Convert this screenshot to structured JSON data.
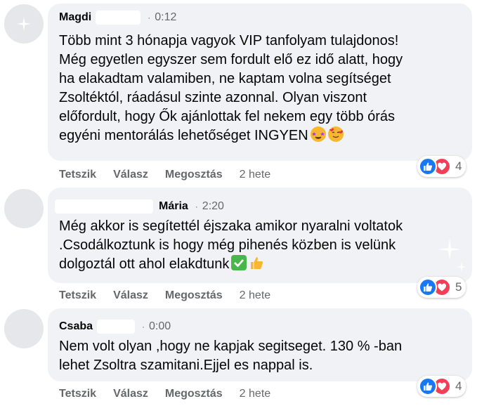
{
  "comments": [
    {
      "author": "Magdi",
      "time": "0:12",
      "text": "Több mint 3 hónapja vagyok VIP tanfolyam tulajdonos!\nMég egyetlen egyszer sem fordult elő ez idő alatt, hogy\nha elakadtam valamiben, ne kaptam volna segítséget\nZsoltéktól, ráadásul szinte azonnal. Olyan viszont\nelőfordult, hogy Ők ajánlottak fel nekem egy több órás\negyéni mentorálás lehetőséget INGYEN",
      "emojis": [
        "star-struck-icon",
        "smiling-face-with-hearts-icon"
      ],
      "reaction_count": "4"
    },
    {
      "author": "Mária",
      "time": "2:20",
      "text": "Még akkor is segítettél éjszaka amikor nyaralni voltatok\n.Csodálkoztunk is hogy még pihenés közben is velünk\ndolgoztál ott ahol elakdtunk",
      "emojis": [
        "check-mark-button-icon",
        "thumbs-up-icon"
      ],
      "reaction_count": "5"
    },
    {
      "author": "Csaba",
      "time": "0:00",
      "text": "Nem volt olyan ,hogy ne kapjak segitseget. 130 % -ban\nlehet Zsoltra szamitani.Ejjel es nappal is.",
      "emojis": [],
      "reaction_count": "4"
    }
  ],
  "actions": {
    "like": "Tetszik",
    "reply": "Válasz",
    "share": "Megosztás",
    "age": "2 hete"
  },
  "separator": "·",
  "colors": {
    "bubble": "#f0f2f5",
    "like": "#1877f2",
    "love": "#f33e58",
    "secondary_text": "#65676b"
  }
}
